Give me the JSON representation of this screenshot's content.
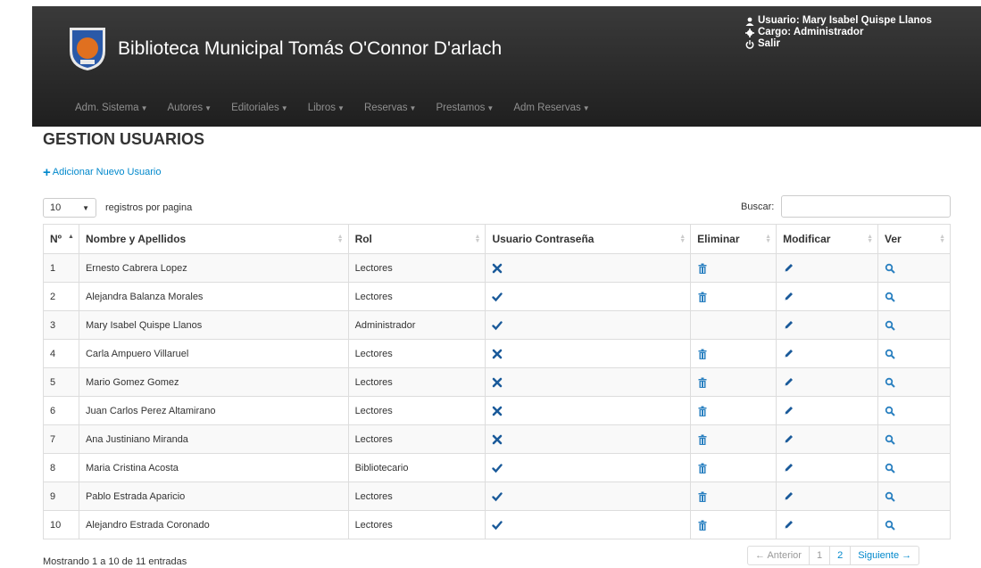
{
  "header": {
    "title": "Biblioteca Municipal Tomás O'Connor D'arlach",
    "user_label": "Usuario: Mary Isabel Quispe Llanos",
    "role_label": "Cargo: Administrador",
    "logout_label": "Salir"
  },
  "menu": [
    "Adm. Sistema",
    "Autores",
    "Editoriales",
    "Libros",
    "Reservas",
    "Prestamos",
    "Adm Reservas"
  ],
  "page": {
    "title": "GESTION USUARIOS",
    "add_label": "Adicionar Nuevo Usuario",
    "length_value": "10",
    "length_label": "registros por pagina",
    "search_label": "Buscar:",
    "search_value": ""
  },
  "table": {
    "headers": [
      "Nº",
      "Nombre y Apellidos",
      "Rol",
      "Usuario Contraseña",
      "Eliminar",
      "Modificar",
      "Ver"
    ],
    "rows": [
      {
        "n": "1",
        "name": "Ernesto Cabrera Lopez",
        "rol": "Lectores",
        "cred": "cross",
        "del": true
      },
      {
        "n": "2",
        "name": "Alejandra Balanza Morales",
        "rol": "Lectores",
        "cred": "check",
        "del": true
      },
      {
        "n": "3",
        "name": "Mary Isabel Quispe Llanos",
        "rol": "Administrador",
        "cred": "check",
        "del": false
      },
      {
        "n": "4",
        "name": "Carla Ampuero Villaruel",
        "rol": "Lectores",
        "cred": "cross",
        "del": true
      },
      {
        "n": "5",
        "name": "Mario Gomez Gomez",
        "rol": "Lectores",
        "cred": "cross",
        "del": true
      },
      {
        "n": "6",
        "name": "Juan Carlos Perez Altamirano",
        "rol": "Lectores",
        "cred": "cross",
        "del": true
      },
      {
        "n": "7",
        "name": "Ana Justiniano Miranda",
        "rol": "Lectores",
        "cred": "cross",
        "del": true
      },
      {
        "n": "8",
        "name": "Maria Cristina Acosta",
        "rol": "Bibliotecario",
        "cred": "check",
        "del": true
      },
      {
        "n": "9",
        "name": "Pablo Estrada Aparicio",
        "rol": "Lectores",
        "cred": "check",
        "del": true
      },
      {
        "n": "10",
        "name": "Alejandro Estrada Coronado",
        "rol": "Lectores",
        "cred": "check",
        "del": true
      }
    ]
  },
  "footer": {
    "info": "Mostrando 1 a 10 de 11 entradas",
    "prev": "← Anterior",
    "pages": [
      "1",
      "2"
    ],
    "next": "Siguiente →"
  },
  "colors": {
    "accent": "#0088cc",
    "navbar": "#2a2a2a"
  }
}
